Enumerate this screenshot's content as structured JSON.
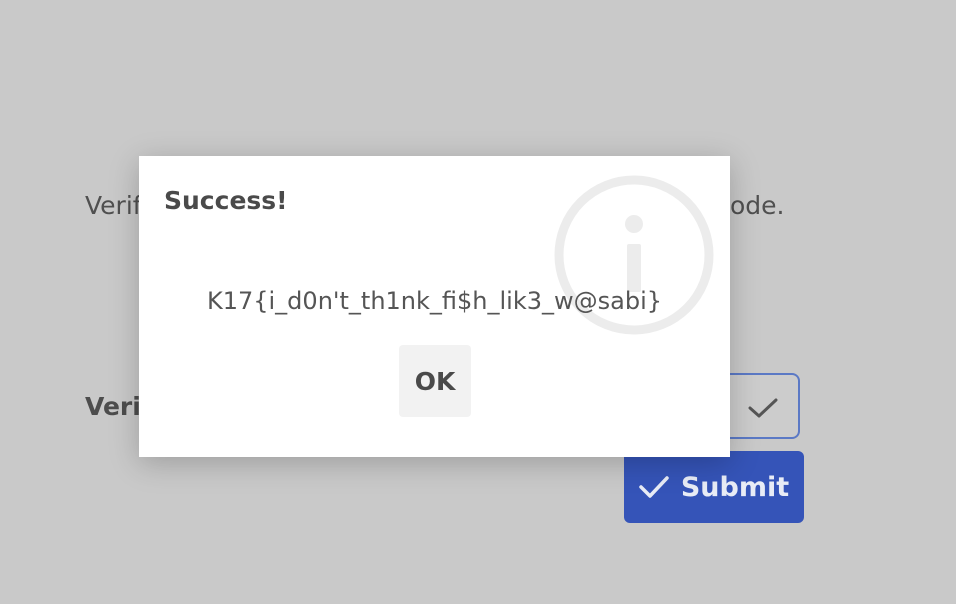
{
  "background": {
    "instruction_start": "Verif",
    "instruction_end": "ode.",
    "field_label": "Verif",
    "submit_label": "Submit"
  },
  "dialog": {
    "title": "Success!",
    "message": "K17{i_d0n't_th1nk_fi$h_lik3_w@sabi}",
    "ok_label": "OK",
    "icon": "info-icon"
  },
  "colors": {
    "overlay": "#c9c9c9",
    "submit_bg": "#3554b8",
    "field_border": "#5b79c5"
  }
}
